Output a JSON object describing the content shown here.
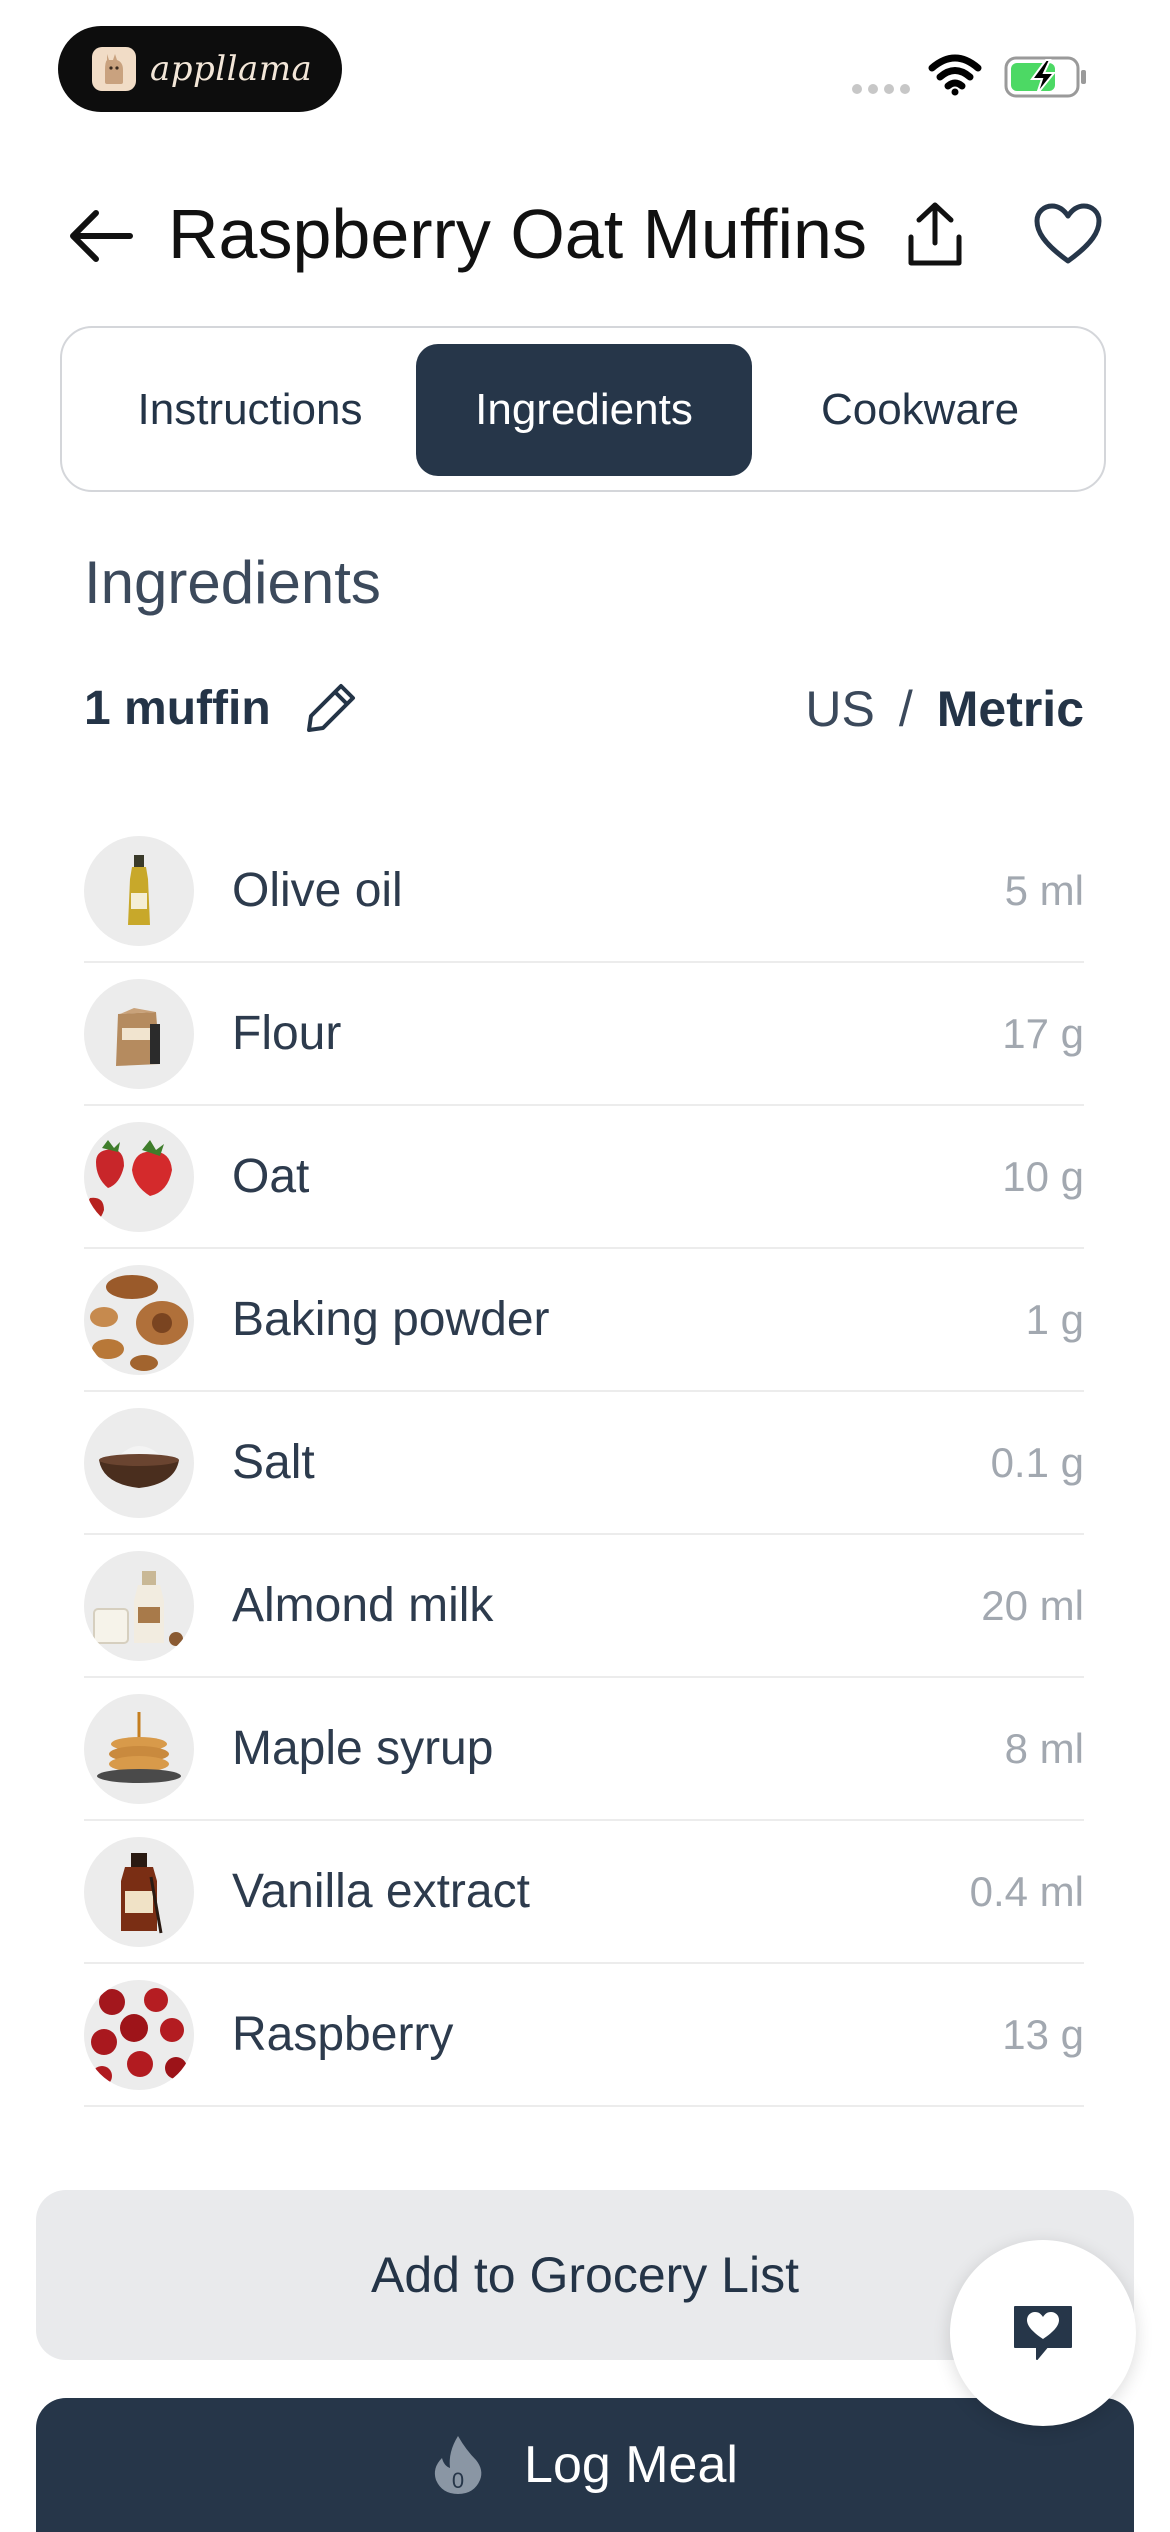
{
  "status_bar": {
    "app_name": "appllama"
  },
  "header": {
    "title": "Raspberry Oat Muffins"
  },
  "tabs": [
    {
      "label": "Instructions",
      "active": false
    },
    {
      "label": "Ingredients",
      "active": true
    },
    {
      "label": "Cookware",
      "active": false
    }
  ],
  "section": {
    "title": "Ingredients",
    "servings": "1 muffin",
    "unit_us": "US",
    "unit_separator": "/",
    "unit_metric": "Metric",
    "selected_unit": "Metric"
  },
  "ingredients": [
    {
      "name": "Olive oil",
      "amount": "5 ml",
      "icon": "olive-oil-bottle"
    },
    {
      "name": "Flour",
      "amount": "17 g",
      "icon": "flour-bag"
    },
    {
      "name": "Oat",
      "amount": "10 g",
      "icon": "strawberries"
    },
    {
      "name": "Baking powder",
      "amount": "1 g",
      "icon": "pastries"
    },
    {
      "name": "Salt",
      "amount": "0.1 g",
      "icon": "salt-bowl"
    },
    {
      "name": "Almond milk",
      "amount": "20 ml",
      "icon": "milk-bottle"
    },
    {
      "name": "Maple syrup",
      "amount": "8 ml",
      "icon": "pancakes"
    },
    {
      "name": "Vanilla extract",
      "amount": "0.4 ml",
      "icon": "vanilla-bottle"
    },
    {
      "name": "Raspberry",
      "amount": "13 g",
      "icon": "raspberries"
    }
  ],
  "buttons": {
    "grocery": "Add to Grocery List",
    "log_meal": "Log Meal",
    "log_badge": "0"
  },
  "colors": {
    "primary": "#263649",
    "secondary_bg": "#e9eaec",
    "amount_text": "#a2a8b0"
  }
}
